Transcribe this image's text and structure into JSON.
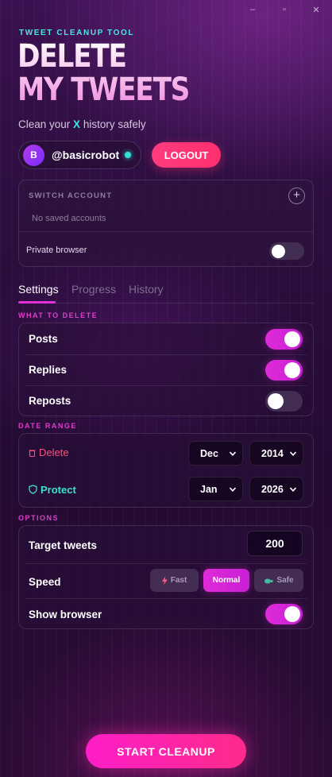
{
  "window": {
    "minimize": "–",
    "maximize": "▫",
    "close": "✕"
  },
  "header": {
    "kicker": "TWEET CLEANUP TOOL",
    "title_line1": "DELETE",
    "title_line2": "MY TWEETS",
    "subtitle_pre": "Clean your ",
    "subtitle_x": "X",
    "subtitle_post": " history safely"
  },
  "account": {
    "avatar_letter": "B",
    "username": "@basicrobot",
    "logout_label": "LOGOUT"
  },
  "switch_account": {
    "label": "SWITCH ACCOUNT",
    "add_icon": "+",
    "empty_text": "No saved accounts",
    "private_browser_label": "Private browser",
    "private_browser_on": false
  },
  "tabs": [
    {
      "label": "Settings",
      "active": true
    },
    {
      "label": "Progress",
      "active": false
    },
    {
      "label": "History",
      "active": false
    }
  ],
  "what_to_delete": {
    "label": "WHAT TO DELETE",
    "items": [
      {
        "label": "Posts",
        "on": true
      },
      {
        "label": "Replies",
        "on": true
      },
      {
        "label": "Reposts",
        "on": false
      }
    ]
  },
  "date_range": {
    "label": "DATE RANGE",
    "delete": {
      "icon": "trash-icon",
      "label": "Delete",
      "month": "Dec",
      "year": "2014"
    },
    "protect": {
      "icon": "shield-icon",
      "label": "Protect",
      "month": "Jan",
      "year": "2026"
    }
  },
  "options": {
    "label": "OPTIONS",
    "target_tweets_label": "Target tweets",
    "target_tweets_value": "200",
    "speed_label": "Speed",
    "speeds": [
      {
        "label": "Fast",
        "icon": "bolt-icon",
        "active": false
      },
      {
        "label": "Normal",
        "icon": "",
        "active": true
      },
      {
        "label": "Safe",
        "icon": "turtle-icon",
        "active": false
      }
    ],
    "show_browser_label": "Show browser",
    "show_browser_on": true
  },
  "start_label": "START CLEANUP",
  "colors": {
    "accent": "#e02bd8",
    "logout": "#ff3c7f",
    "cyan": "#3fe0e0",
    "start": "#ff1ec8"
  }
}
